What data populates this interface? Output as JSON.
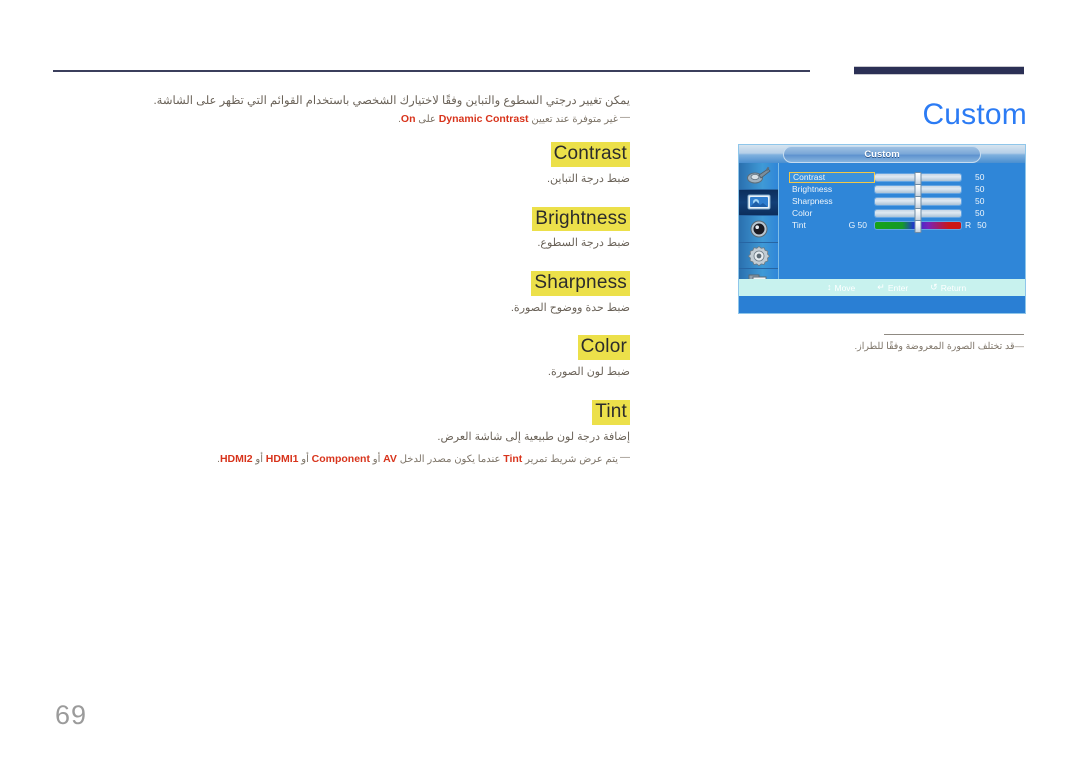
{
  "page": {
    "number": "69",
    "title": "Custom"
  },
  "intro": {
    "paragraph": "يمكن تغيير درجتي السطوع والتباين وفقًا لاختيارك الشخصي باستخدام القوائم التي تظهر على الشاشة.",
    "note_prefix": "غير متوفرة عند تعيين",
    "note_kw1": "Dynamic Contrast",
    "note_mid": "على",
    "note_kw2": "On",
    "note_suffix": "."
  },
  "sections": [
    {
      "heading": "Contrast",
      "description": "ضبط درجة التباين."
    },
    {
      "heading": "Brightness",
      "description": "ضبط درجة السطوع."
    },
    {
      "heading": "Sharpness",
      "description": "ضبط حدة ووضوح الصورة."
    },
    {
      "heading": "Color",
      "description": "ضبط لون الصورة."
    },
    {
      "heading": "Tint",
      "description": "إضافة درجة لون طبيعية إلى شاشة العرض."
    }
  ],
  "tint_note": {
    "prefix": "يتم عرض شريط تمرير",
    "kw1": "Tint",
    "mid1": "عندما يكون مصدر الدخل",
    "kw2": "AV",
    "or1": "أو",
    "kw3": "Component",
    "or2": "أو",
    "kw4": "HDMI1",
    "or3": "أو",
    "kw5": "HDMI2",
    "suffix": "."
  },
  "osd": {
    "title": "Custom",
    "sidebar_icons": [
      {
        "name": "input-source-icon",
        "active": false
      },
      {
        "name": "picture-icon",
        "active": true
      },
      {
        "name": "sound-icon",
        "active": false
      },
      {
        "name": "system-gear-icon",
        "active": false
      },
      {
        "name": "support-pages-icon",
        "active": false
      }
    ],
    "rows": [
      {
        "label": "Contrast",
        "value": "50",
        "selected": true,
        "type": "bar",
        "knob_pct": 50
      },
      {
        "label": "Brightness",
        "value": "50",
        "selected": false,
        "type": "bar",
        "knob_pct": 50
      },
      {
        "label": "Sharpness",
        "value": "50",
        "selected": false,
        "type": "bar",
        "knob_pct": 50
      },
      {
        "label": "Color",
        "value": "50",
        "selected": false,
        "type": "bar",
        "knob_pct": 50
      },
      {
        "label": "Tint",
        "value": "50",
        "selected": false,
        "type": "rgb",
        "knob_pct": 50,
        "g_label": "G  50",
        "r_label": "R"
      }
    ],
    "footer": [
      {
        "glyph": "↕",
        "label": "Move",
        "name": "move-hint"
      },
      {
        "glyph": "↵",
        "label": "Enter",
        "name": "enter-hint"
      },
      {
        "glyph": "↺",
        "label": "Return",
        "name": "return-hint"
      }
    ]
  },
  "osd_caption": {
    "dash": "—",
    "text": "قد تختلف الصورة المعروضة وفقًا للطراز."
  },
  "colors": {
    "title_blue": "#2b7bf4",
    "heading_highlight": "#ece04a",
    "keyword_red": "#d8341c",
    "body_text": "#6a6258",
    "osd_blue": "#2f86d8",
    "osd_select_border": "#f2c744",
    "rule_navy": "#3b3f5c",
    "footer_mint": "#c8f2ee"
  }
}
